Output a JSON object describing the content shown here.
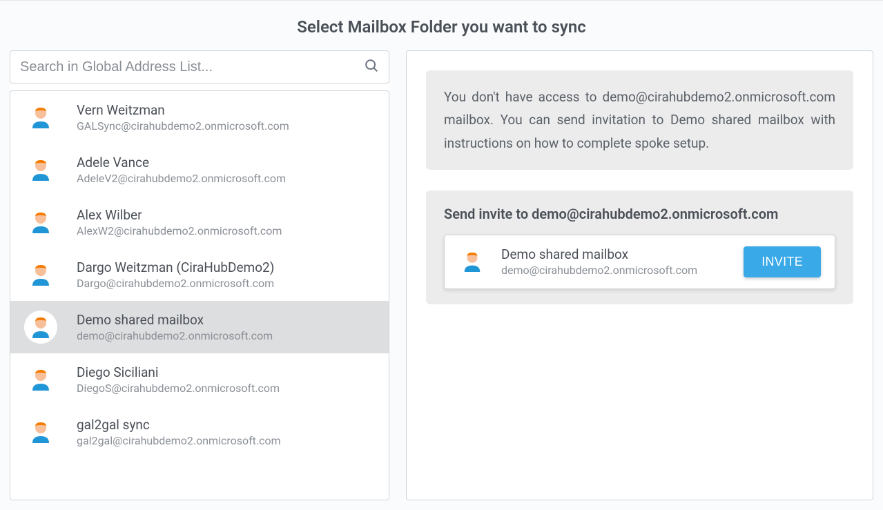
{
  "header": {
    "title": "Select Mailbox Folder you want to sync"
  },
  "search": {
    "placeholder": "Search in Global Address List..."
  },
  "contacts": [
    {
      "name": "Vern Weitzman",
      "email": "GALSync@cirahubdemo2.onmicrosoft.com",
      "selected": false
    },
    {
      "name": "Adele Vance",
      "email": "AdeleV2@cirahubdemo2.onmicrosoft.com",
      "selected": false
    },
    {
      "name": "Alex Wilber",
      "email": "AlexW2@cirahubdemo2.onmicrosoft.com",
      "selected": false
    },
    {
      "name": "Dargo Weitzman (CiraHubDemo2)",
      "email": "Dargo@cirahubdemo2.onmicrosoft.com",
      "selected": false
    },
    {
      "name": "Demo shared mailbox",
      "email": "demo@cirahubdemo2.onmicrosoft.com",
      "selected": true
    },
    {
      "name": "Diego Siciliani",
      "email": "DiegoS@cirahubdemo2.onmicrosoft.com",
      "selected": false
    },
    {
      "name": "gal2gal sync",
      "email": "gal2gal@cirahubdemo2.onmicrosoft.com",
      "selected": false
    }
  ],
  "info_text": "You don't have access to demo@cirahubdemo2.onmicrosoft.com mailbox. You can send invitation to Demo shared mailbox with instructions on how to complete spoke setup.",
  "invite": {
    "title": "Send invite to demo@cirahubdemo2.onmicrosoft.com",
    "name": "Demo shared mailbox",
    "email": "demo@cirahubdemo2.onmicrosoft.com",
    "button": "INVITE"
  }
}
